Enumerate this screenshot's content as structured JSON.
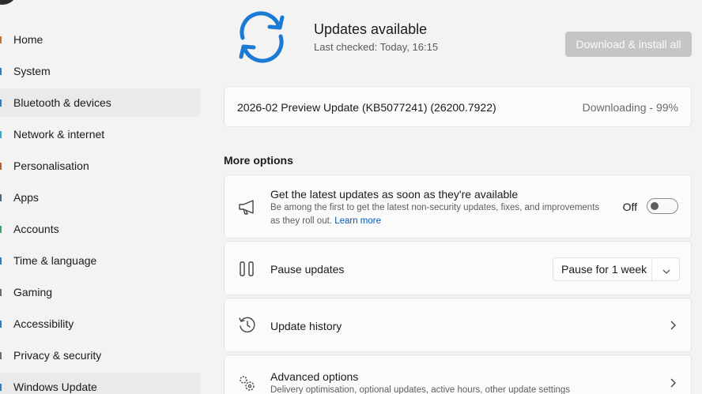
{
  "sidebar": {
    "items": [
      {
        "label": "Home",
        "icon": "home-icon",
        "color": "#d36b2b"
      },
      {
        "label": "System",
        "icon": "system-icon",
        "color": "#2a7fd4"
      },
      {
        "label": "Bluetooth & devices",
        "icon": "bluetooth-icon",
        "color": "#2a7fd4"
      },
      {
        "label": "Network & internet",
        "icon": "network-icon",
        "color": "#2fa8c9"
      },
      {
        "label": "Personalisation",
        "icon": "personalisation-icon",
        "color": "#c45a2a"
      },
      {
        "label": "Apps",
        "icon": "apps-icon",
        "color": "#4a6b8a"
      },
      {
        "label": "Accounts",
        "icon": "accounts-icon",
        "color": "#2fa86b"
      },
      {
        "label": "Time & language",
        "icon": "time-language-icon",
        "color": "#2a7fd4"
      },
      {
        "label": "Gaming",
        "icon": "gaming-icon",
        "color": "#6b6b6b"
      },
      {
        "label": "Accessibility",
        "icon": "accessibility-icon",
        "color": "#2a7fd4"
      },
      {
        "label": "Privacy & security",
        "icon": "privacy-icon",
        "color": "#6b6b6b"
      },
      {
        "label": "Windows Update",
        "icon": "windows-update-icon",
        "color": "#2a7fd4"
      }
    ]
  },
  "header": {
    "title": "Updates available",
    "last_checked": "Last checked: Today, 16:15",
    "install_button": "Download & install all",
    "accent": "#1a7ad4"
  },
  "pending_update": {
    "name": "2026-02 Preview Update (KB5077241) (26200.7922)",
    "status": "Downloading - 99%",
    "progress_percent": 99
  },
  "more_options": {
    "title": "More options",
    "latest_updates": {
      "title": "Get the latest updates as soon as they're available",
      "desc": "Be among the first to get the latest non-security updates, fixes, and improvements as they roll out.",
      "link": "Learn more",
      "toggle_state": "Off"
    },
    "pause": {
      "title": "Pause updates",
      "selected": "Pause for 1 week"
    },
    "history": {
      "title": "Update history"
    },
    "advanced": {
      "title": "Advanced options",
      "desc": "Delivery optimisation, optional updates, active hours, other update settings"
    }
  }
}
